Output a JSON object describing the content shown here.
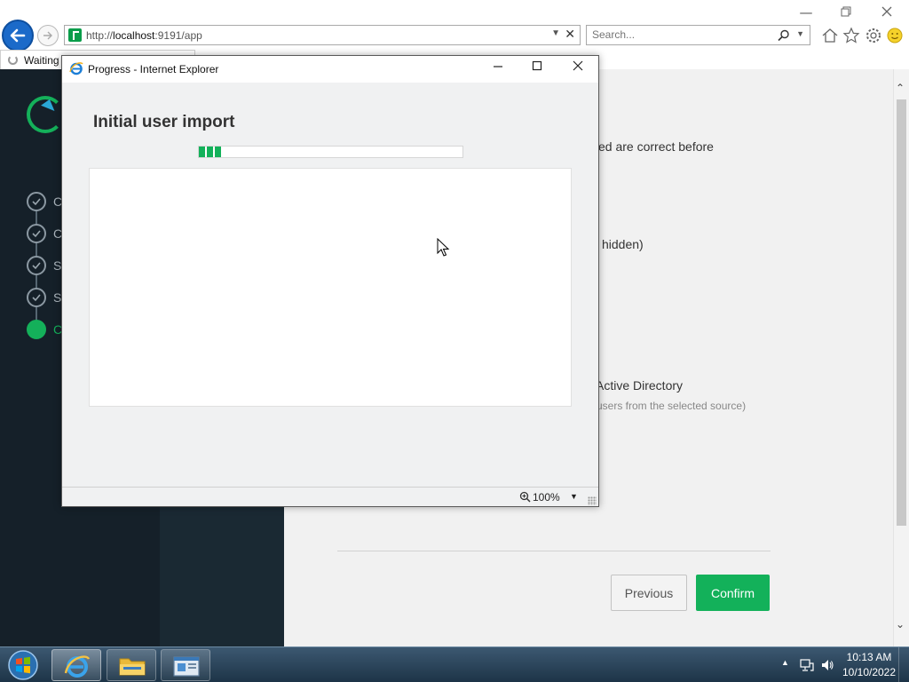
{
  "browser": {
    "url_plain": "http://",
    "url_host": "localhost",
    "url_rest": ":9191/app",
    "search_placeholder": "Search...",
    "tab_label": "Waiting"
  },
  "app": {
    "step_labels": [
      "C",
      "C",
      "S",
      "S",
      "C"
    ],
    "main_texts": {
      "correct_before": "ed are correct before",
      "hidden": "hidden)",
      "active_directory": "Active Directory",
      "users_from_source": "users from the selected source)"
    },
    "previous_label": "Previous",
    "confirm_label": "Confirm",
    "accent_color": "#13b15a"
  },
  "dialog": {
    "title": "Progress - Internet Explorer",
    "heading": "Initial user import",
    "progress_fraction": 0.09,
    "zoom_label": "100%"
  },
  "taskbar": {
    "time": "10:13 AM",
    "date": "10/10/2022"
  }
}
